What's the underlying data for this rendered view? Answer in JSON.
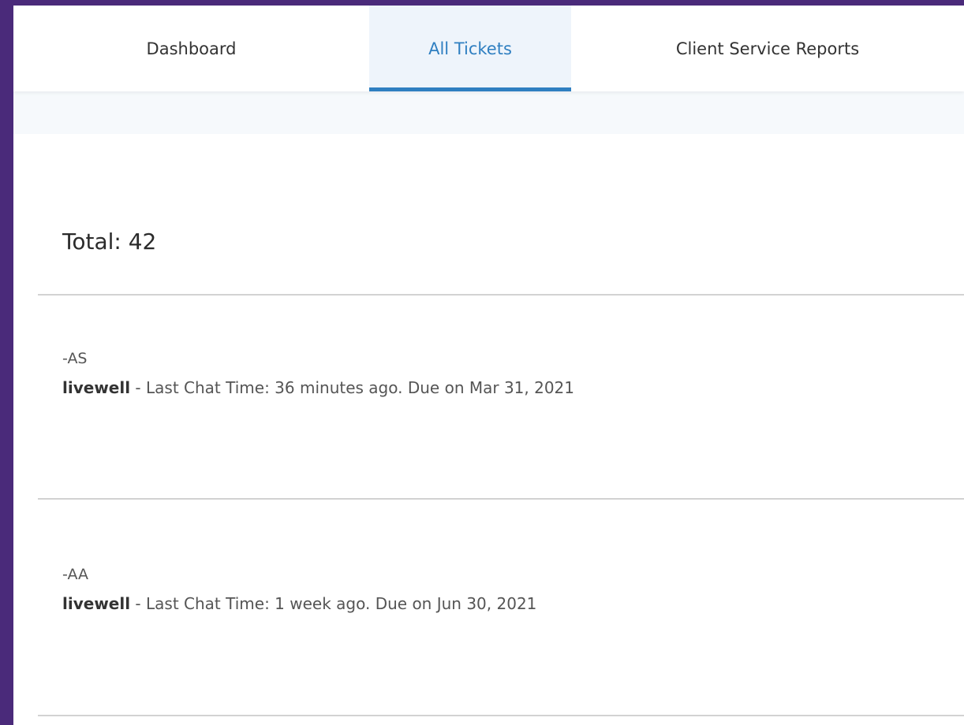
{
  "tabs": [
    {
      "label": "Dashboard",
      "active": false
    },
    {
      "label": "All Tickets",
      "active": true
    },
    {
      "label": "Client Service Reports",
      "active": false
    }
  ],
  "summary": {
    "total_label": "Total: 42"
  },
  "tickets": [
    {
      "code": "-AS",
      "client": "livewell",
      "separator": " - ",
      "details": "Last Chat Time: 36 minutes ago. Due on Mar 31, 2021"
    },
    {
      "code": "-AA",
      "client": "livewell",
      "separator": " - ",
      "details": "Last Chat Time: 1 week ago. Due on Jun 30, 2021"
    }
  ],
  "colors": {
    "background": "#4a2a7a",
    "accent": "#2f7fc1",
    "active_tab_bg": "#eef4fb"
  }
}
